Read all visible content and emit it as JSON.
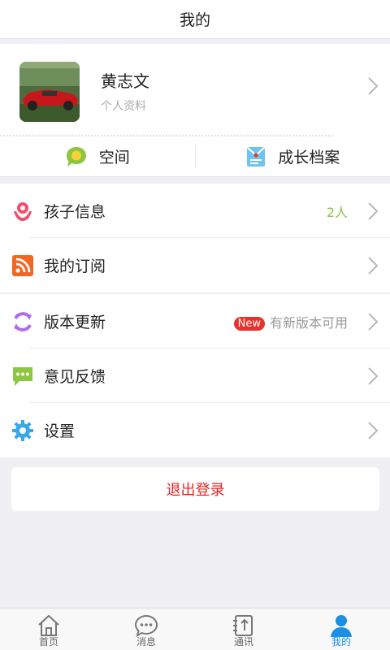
{
  "header": {
    "title": "我的"
  },
  "profile": {
    "name": "黄志文",
    "subtitle": "个人资料"
  },
  "quick_links": [
    {
      "label": "空间",
      "icon": "chat-bubble-icon"
    },
    {
      "label": "成长档案",
      "icon": "envelope-icon"
    }
  ],
  "group1": [
    {
      "label": "孩子信息",
      "value": "2人",
      "icon": "child-icon"
    },
    {
      "label": "我的订阅",
      "icon": "rss-icon"
    }
  ],
  "group2": [
    {
      "label": "版本更新",
      "badge": "New",
      "value": "有新版本可用",
      "icon": "refresh-icon"
    },
    {
      "label": "意见反馈",
      "icon": "message-icon"
    },
    {
      "label": "设置",
      "icon": "gear-icon"
    }
  ],
  "logout": {
    "label": "退出登录"
  },
  "tabbar": [
    {
      "label": "首页",
      "icon": "home-icon",
      "active": false
    },
    {
      "label": "消息",
      "icon": "chat-icon",
      "active": false
    },
    {
      "label": "通讯",
      "icon": "contacts-icon",
      "active": false
    },
    {
      "label": "我的",
      "icon": "person-icon",
      "active": true
    }
  ],
  "colors": {
    "accent": "#1a8fe3",
    "danger": "#e8231f",
    "value_green": "#8bc34a",
    "badge_red": "#e8312a"
  }
}
